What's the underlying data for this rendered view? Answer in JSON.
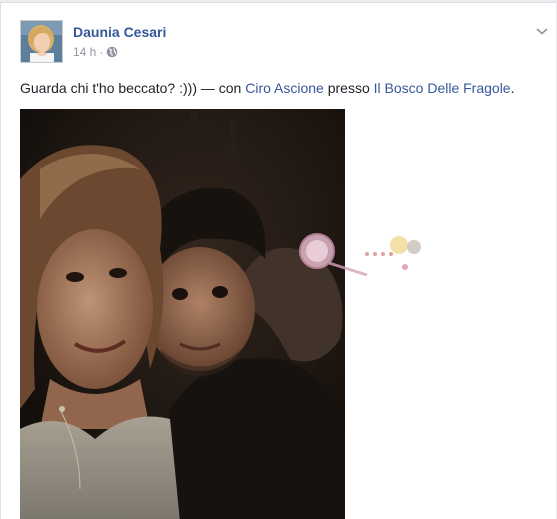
{
  "post": {
    "author_name": "Daunia Cesari",
    "timestamp": "14 h",
    "separator": "·",
    "privacy_icon": "globe-icon",
    "menu_icon": "chevron-down-icon",
    "status": {
      "text_before": "Guarda chi t'ho beccato? :))) — con ",
      "tagged_person": "Ciro Ascione",
      "text_middle": " presso ",
      "location": "Il Bosco Delle Fragole",
      "text_after": "."
    },
    "photo": {
      "description_icon": "photo-selfie"
    }
  },
  "watermark": {
    "logo_icon": "watermark-logo"
  },
  "colors": {
    "link": "#365899",
    "text": "#1d2129",
    "meta": "#90949c",
    "background": "#e9ebee",
    "card": "#ffffff"
  }
}
